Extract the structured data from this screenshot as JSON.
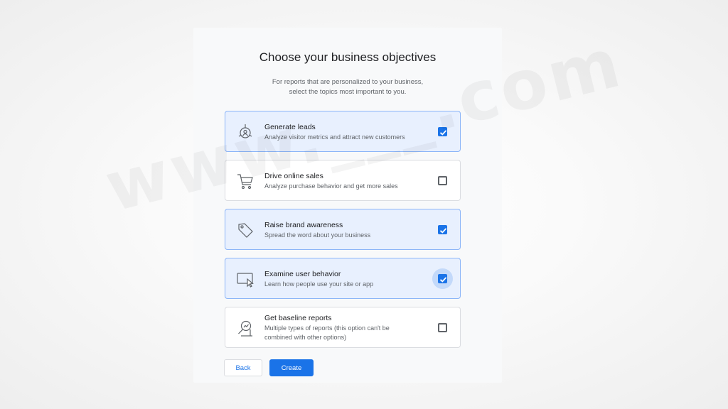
{
  "watermark": "www.___.com",
  "dialog": {
    "title": "Choose your business objectives",
    "subtitle_line1": "For reports that are personalized to your business,",
    "subtitle_line2": "select the topics most important to you."
  },
  "options": [
    {
      "title": "Generate leads",
      "description": "Analyze visitor metrics and attract new customers",
      "checked": true,
      "icon": "target-person-icon"
    },
    {
      "title": "Drive online sales",
      "description": "Analyze purchase behavior and get more sales",
      "checked": false,
      "icon": "shopping-cart-icon"
    },
    {
      "title": "Raise brand awareness",
      "description": "Spread the word about your business",
      "checked": true,
      "icon": "tag-icon"
    },
    {
      "title": "Examine user behavior",
      "description": "Learn how people use your site or app",
      "checked": true,
      "focused": true,
      "icon": "cursor-on-screen-icon"
    },
    {
      "title": "Get baseline reports",
      "description": "Multiple types of reports (this option can't be combined with other options)",
      "checked": false,
      "icon": "magnifier-report-icon"
    }
  ],
  "buttons": {
    "back": "Back",
    "create": "Create"
  },
  "colors": {
    "accent": "#1a73e8",
    "selected_bg": "#e8f0fe",
    "selected_border": "#8ab4f8",
    "panel_bg": "#f8f9fa"
  }
}
